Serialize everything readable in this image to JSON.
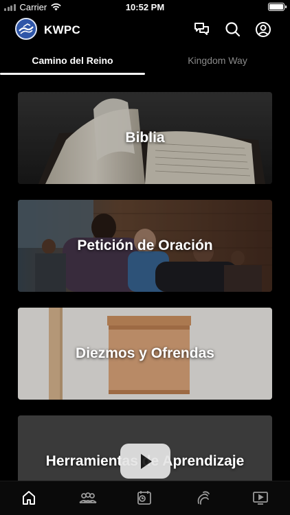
{
  "status_bar": {
    "carrier": "Carrier",
    "time": "10:52 PM"
  },
  "header": {
    "title": "KWPC",
    "icons": [
      "chat-bubbles-icon",
      "search-icon",
      "profile-icon"
    ]
  },
  "tabs": [
    {
      "label": "Camino del Reino",
      "active": true
    },
    {
      "label": "Kingdom Way",
      "active": false
    }
  ],
  "cards": [
    {
      "label": "Biblia",
      "image": "open-bible-photo"
    },
    {
      "label": "Petición de Oración",
      "image": "prayer-group-photo"
    },
    {
      "label": "Diezmos y Ofrendas",
      "image": "wooden-offering-box-photo"
    },
    {
      "label": "Herramientas de Aprendizaje",
      "image": "video-thumbnail"
    }
  ],
  "bottom_nav": [
    {
      "icon": "home-icon",
      "active": true
    },
    {
      "icon": "community-icon",
      "active": false
    },
    {
      "icon": "calendar-clock-icon",
      "active": false
    },
    {
      "icon": "giving-icon",
      "active": false
    },
    {
      "icon": "tv-play-icon",
      "active": false
    }
  ],
  "colors": {
    "background": "#000000",
    "active_tab": "#ffffff",
    "inactive_tab": "#8a8a8a",
    "logo_blue": "#2f56a8"
  }
}
